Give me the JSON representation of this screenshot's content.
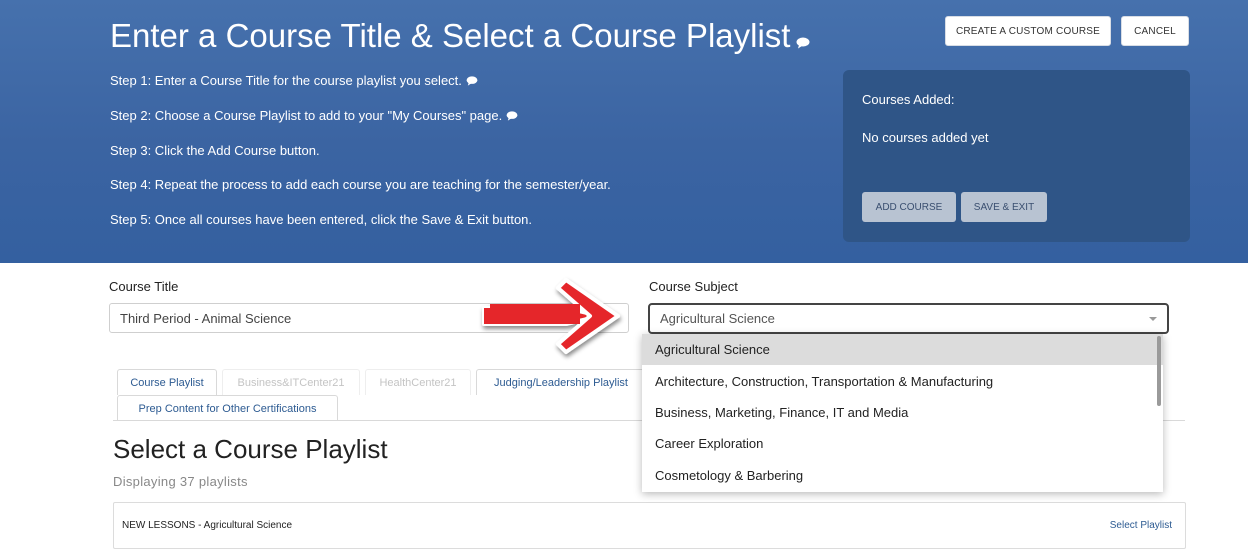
{
  "header": {
    "title": "Enter a Course Title & Select a Course Playlist",
    "steps": [
      "Step 1: Enter a Course Title for the course playlist you select.",
      "Step 2: Choose a Course Playlist to add to your \"My Courses\" page.",
      "Step 3: Click the Add Course button.",
      "Step 4: Repeat the process to add each course you are teaching for the semester/year.",
      "Step 5: Once all courses have been entered, click the Save & Exit button."
    ],
    "create_custom_course_label": "CREATE A CUSTOM COURSE",
    "cancel_label": "CANCEL"
  },
  "courses_panel": {
    "label": "Courses Added:",
    "empty_text": "No courses added yet",
    "add_course_label": "ADD COURSE",
    "save_exit_label": "SAVE & EXIT"
  },
  "form": {
    "course_title_label": "Course Title",
    "course_title_value": "Third Period - Animal Science",
    "course_subject_label": "Course Subject",
    "course_subject_value": "Agricultural Science"
  },
  "dropdown": {
    "options": [
      "Agricultural Science",
      "Architecture, Construction, Transportation & Manufacturing",
      "Business, Marketing, Finance, IT and Media",
      "Career Exploration",
      "Cosmetology & Barbering"
    ],
    "selected_index": 0
  },
  "tabs": [
    "Course Playlist",
    "Business&ITCenter21",
    "HealthCenter21",
    "Judging/Leadership Playlist",
    "Prep Content for Other Certifications"
  ],
  "playlist_section": {
    "title": "Select a Course Playlist",
    "count_text": "Displaying 37 playlists",
    "rows": [
      {
        "name": "NEW LESSONS - Agricultural Science",
        "action": "Select Playlist"
      }
    ]
  },
  "colors": {
    "header_bg": "#3c66a4",
    "panel_bg": "#2f5587",
    "link": "#2d5b92",
    "arrow": "#e5262b"
  },
  "icons": [
    "speech-bubble-icon",
    "dropdown-caret-icon",
    "red-arrow-icon"
  ]
}
